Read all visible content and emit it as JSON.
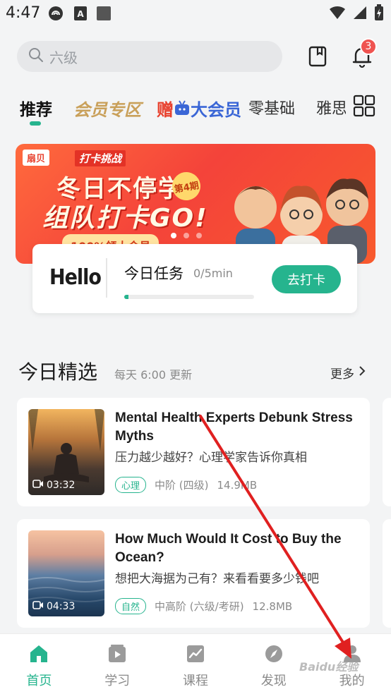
{
  "status_bar": {
    "time": "4:47"
  },
  "search": {
    "placeholder": "六级"
  },
  "notifications": {
    "badge_count": "3"
  },
  "tabs": [
    {
      "label": "推荐",
      "active": true
    },
    {
      "label": "会员专区"
    },
    {
      "label_a": "赠",
      "label_b": "大会员"
    },
    {
      "label": "零基础"
    },
    {
      "label": "雅思"
    }
  ],
  "banner": {
    "logo": "扇贝",
    "subtitle": "打卡挑战",
    "title_line1": "冬日不停学",
    "title_line2": "组队打卡GO!",
    "badge": "第4期",
    "bottom_text": "100%领大会员",
    "slide_count": 3,
    "active_slide": 0
  },
  "task": {
    "hello": "Hello",
    "title": "今日任务",
    "progress_text": "0/5min",
    "progress": 0.03,
    "button_label": "去打卡"
  },
  "section": {
    "title": "今日精选",
    "subtitle": "每天 6:00 更新",
    "more_label": "更多"
  },
  "cards": [
    {
      "duration": "03:32",
      "title": "Mental Health Experts Debunk Stress Myths",
      "subtitle": "压力越少越好？心理学家告诉你真相",
      "tag": "心理",
      "level": "中阶 (四级)",
      "size": "14.9MB"
    },
    {
      "duration": "04:33",
      "title": "How Much Would It Cost to Buy the Ocean?",
      "subtitle": "想把大海据为己有？来看看要多少钱吧",
      "tag": "自然",
      "level": "中高阶 (六级/考研)",
      "size": "12.8MB"
    }
  ],
  "bottom_nav": [
    {
      "label": "首页",
      "icon": "home-icon",
      "active": true
    },
    {
      "label": "学习",
      "icon": "play-icon"
    },
    {
      "label": "课程",
      "icon": "chart-icon"
    },
    {
      "label": "发现",
      "icon": "compass-icon"
    },
    {
      "label": "我的",
      "icon": "profile-icon"
    }
  ],
  "watermark": "Baidu经验",
  "colors": {
    "accent": "#26b48e",
    "badge": "#ef5350",
    "annotation": "#e02020"
  }
}
